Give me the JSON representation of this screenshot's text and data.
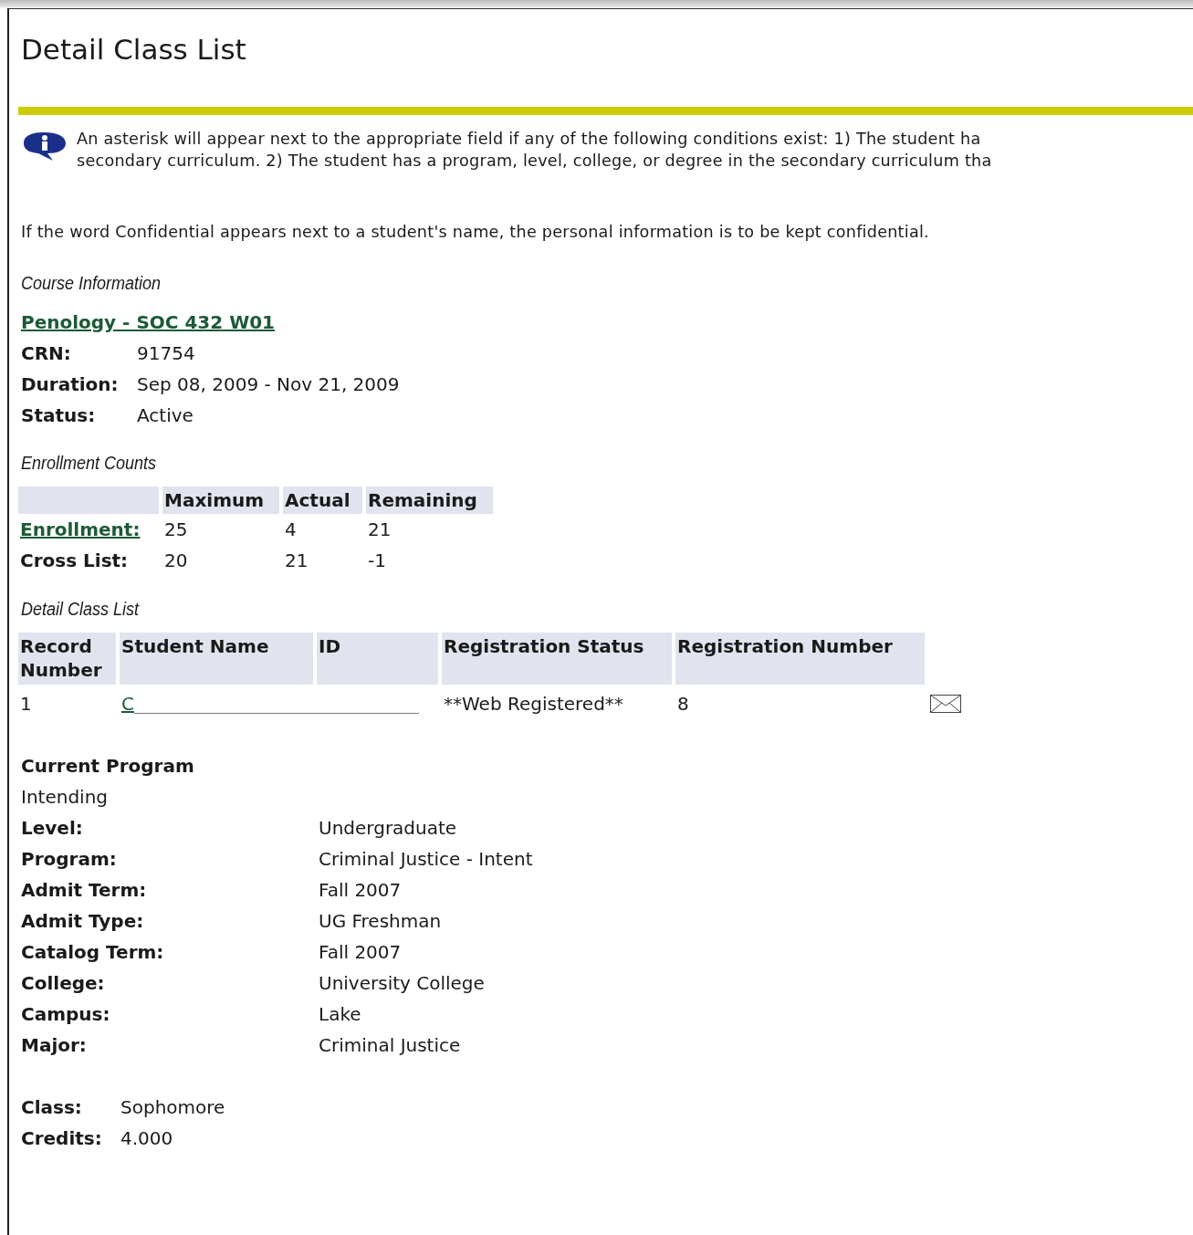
{
  "page": {
    "title": "Detail Class List"
  },
  "info_note": {
    "lines": [
      "An asterisk will appear next to the appropriate field if any of the following conditions exist: 1) The student ha",
      "secondary curriculum. 2) The student has a program, level, college, or degree in the secondary curriculum tha"
    ]
  },
  "confidential_note": "If the word Confidential appears next to a student's name, the personal information is to be kept confidential.",
  "course_information": {
    "heading": "Course Information",
    "course_link": "Penology - SOC 432 W01",
    "fields": [
      {
        "label": "CRN:",
        "value": "91754"
      },
      {
        "label": "Duration:",
        "value": "Sep 08, 2009 - Nov 21, 2009"
      },
      {
        "label": "Status:",
        "value": "Active"
      }
    ]
  },
  "enrollment_counts": {
    "heading": "Enrollment Counts",
    "columns": [
      "Maximum",
      "Actual",
      "Remaining"
    ],
    "rows": [
      {
        "label": "Enrollment:",
        "kind": "link",
        "values": [
          "25",
          "4",
          "21"
        ]
      },
      {
        "label": "Cross List:",
        "kind": "text",
        "values": [
          "20",
          "21",
          "-1"
        ]
      }
    ]
  },
  "detail_class_list": {
    "heading": "Detail Class List",
    "columns": [
      "Record Number",
      "Student Name",
      "ID",
      "Registration Status",
      "Registration Number"
    ],
    "rows": [
      {
        "record_number": "1",
        "student_name": "C",
        "redacted": true,
        "registration_status": "**Web Registered**",
        "registration_number": "8"
      }
    ]
  },
  "current_program": {
    "heading": "Current Program",
    "subheading": "Intending",
    "fields": [
      {
        "label": "Level:",
        "value": "Undergraduate"
      },
      {
        "label": "Program:",
        "value": "Criminal Justice - Intent"
      },
      {
        "label": "Admit Term:",
        "value": "Fall 2007"
      },
      {
        "label": "Admit Type:",
        "value": "UG Freshman"
      },
      {
        "label": "Catalog Term:",
        "value": "Fall 2007"
      },
      {
        "label": "College:",
        "value": "University College"
      },
      {
        "label": "Campus:",
        "value": "Lake"
      },
      {
        "label": "Major:",
        "value": "Criminal Justice"
      }
    ]
  },
  "class_info": {
    "fields": [
      {
        "label": "Class:",
        "value": "Sophomore"
      },
      {
        "label": "Credits:",
        "value": "4.000"
      }
    ]
  }
}
